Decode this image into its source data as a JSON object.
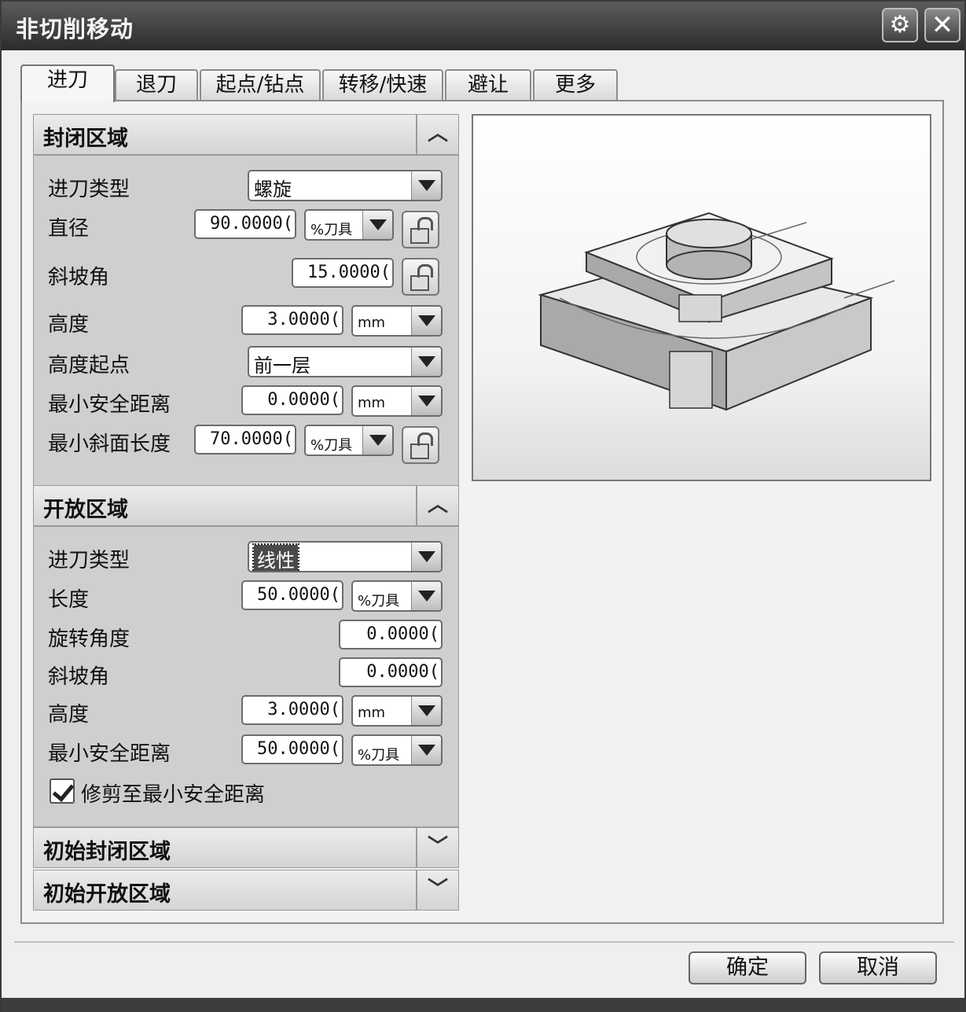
{
  "window": {
    "title": "非切削移动"
  },
  "tabs": [
    "进刀",
    "退刀",
    "起点/钻点",
    "转移/快速",
    "避让",
    "更多"
  ],
  "closed_region": {
    "title": "封闭区域",
    "toggle": "^",
    "engage_type_label": "进刀类型",
    "engage_type_value": "螺旋",
    "diameter_label": "直径",
    "diameter_value": "90.0000(",
    "diameter_unit": "%刀具",
    "ramp_angle_label": "斜坡角",
    "ramp_angle_value": "15.0000(",
    "height_label": "高度",
    "height_value": "3.0000(",
    "height_unit": "mm",
    "height_from_label": "高度起点",
    "height_from_value": "前一层",
    "min_clearance_label": "最小安全距离",
    "min_clearance_value": "0.0000(",
    "min_clearance_unit": "mm",
    "min_ramp_len_label": "最小斜面长度",
    "min_ramp_len_value": "70.0000(",
    "min_ramp_len_unit": "%刀具"
  },
  "open_region": {
    "title": "开放区域",
    "toggle": "^",
    "engage_type_label": "进刀类型",
    "engage_type_value": "线性",
    "length_label": "长度",
    "length_value": "50.0000(",
    "length_unit": "%刀具",
    "rotation_label": "旋转角度",
    "rotation_value": "0.0000(",
    "ramp_angle_label": "斜坡角",
    "ramp_angle_value": "0.0000(",
    "height_label": "高度",
    "height_value": "3.0000(",
    "height_unit": "mm",
    "min_clearance_label": "最小安全距离",
    "min_clearance_value": "50.0000(",
    "min_clearance_unit": "%刀具",
    "trim_label": "修剪至最小安全距离",
    "trim_checked": true
  },
  "initial_closed": {
    "title": "初始封闭区域",
    "toggle": "v"
  },
  "initial_open": {
    "title": "初始开放区域",
    "toggle": "v"
  },
  "footer": {
    "ok": "确定",
    "cancel": "取消"
  },
  "icons": {
    "settings": "gear-icon",
    "close": "close-icon",
    "lock": "lock-icon"
  }
}
